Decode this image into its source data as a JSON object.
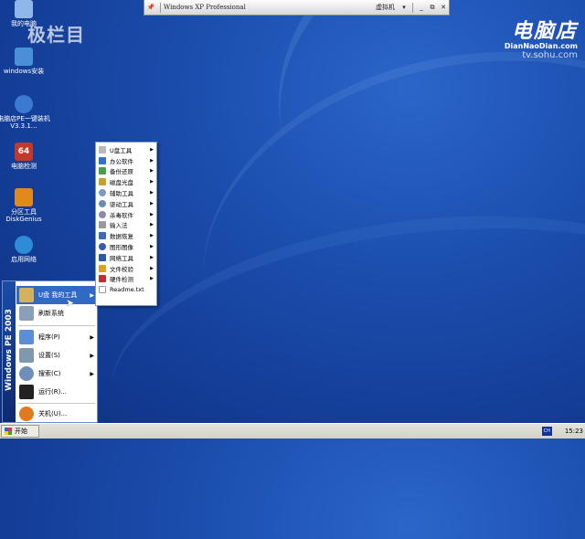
{
  "watermarks": {
    "left": "极栏目",
    "brand": "电脑店",
    "brand_sub": "DianNaoDian.com",
    "url": "tv.sohu.com"
  },
  "desktop_icons": [
    {
      "label": "我的电脑",
      "icon": "computer-icon",
      "color": "#8fb8e8"
    },
    {
      "label": "windows安装",
      "icon": "installer-icon",
      "color": "#4a90d9"
    },
    {
      "label": "电脑店PE一键装机 V3.3.1…",
      "icon": "pe-install-icon",
      "color": "#3a7ad0"
    },
    {
      "label": "电脑检测",
      "icon": "pc-test-64-icon",
      "color": "#c0392b"
    },
    {
      "label": "分区工具 DiskGenius",
      "icon": "diskgenius-icon",
      "color": "#e08a1e"
    },
    {
      "label": "启用网络",
      "icon": "network-icon",
      "color": "#2e8bd8"
    }
  ],
  "vm_bar": {
    "pin": "📌",
    "title": "Windows XP Professional",
    "vm_menu": "虚拟机",
    "buttons": [
      "_",
      "⧉",
      "✕"
    ]
  },
  "start_menu": {
    "banner": "Windows PE 2003",
    "items": [
      {
        "label": "U盘 我的工具",
        "icon": "usb-tools-icon",
        "has_submenu": true,
        "active": true
      },
      {
        "label": "刷新系统",
        "icon": "refresh-system-icon",
        "has_submenu": false,
        "active": false
      },
      {
        "label": "程序(P)",
        "icon": "programs-icon",
        "has_submenu": true,
        "active": false
      },
      {
        "label": "设置(S)",
        "icon": "settings-icon",
        "has_submenu": true,
        "active": false
      },
      {
        "label": "搜索(C)",
        "icon": "search-icon",
        "has_submenu": true,
        "active": false
      },
      {
        "label": "运行(R)...",
        "icon": "run-icon",
        "has_submenu": false,
        "active": false
      },
      {
        "label": "关机(U)...",
        "icon": "shutdown-icon",
        "has_submenu": false,
        "active": false
      }
    ]
  },
  "submenu": {
    "items": [
      {
        "label": "U盘工具",
        "icon": "usb-icon",
        "has_submenu": true
      },
      {
        "label": "办公软件",
        "icon": "office-icon",
        "has_submenu": true
      },
      {
        "label": "备份还原",
        "icon": "backup-icon",
        "has_submenu": true
      },
      {
        "label": "磁盘光盘",
        "icon": "disk-icon",
        "has_submenu": true
      },
      {
        "label": "辅助工具",
        "icon": "aux-tools-icon",
        "has_submenu": true
      },
      {
        "label": "驱动工具",
        "icon": "driver-icon",
        "has_submenu": true
      },
      {
        "label": "杀毒软件",
        "icon": "antivirus-icon",
        "has_submenu": true
      },
      {
        "label": "输入法",
        "icon": "ime-icon",
        "has_submenu": true
      },
      {
        "label": "数据恢复",
        "icon": "data-recovery-icon",
        "has_submenu": true
      },
      {
        "label": "图形图像",
        "icon": "graphics-icon",
        "has_submenu": true
      },
      {
        "label": "网络工具",
        "icon": "network-tools-icon",
        "has_submenu": true
      },
      {
        "label": "文件校验",
        "icon": "file-check-icon",
        "has_submenu": true
      },
      {
        "label": "硬件检测",
        "icon": "hardware-icon",
        "has_submenu": true
      },
      {
        "label": "Readme.txt",
        "icon": "text-file-icon",
        "has_submenu": false
      }
    ]
  },
  "taskbar": {
    "start_label": "开始",
    "ime": "CH",
    "clock": "15:23"
  },
  "colors": {
    "menu_highlight": "#316ac5",
    "desktop": "#1c4fb0"
  }
}
